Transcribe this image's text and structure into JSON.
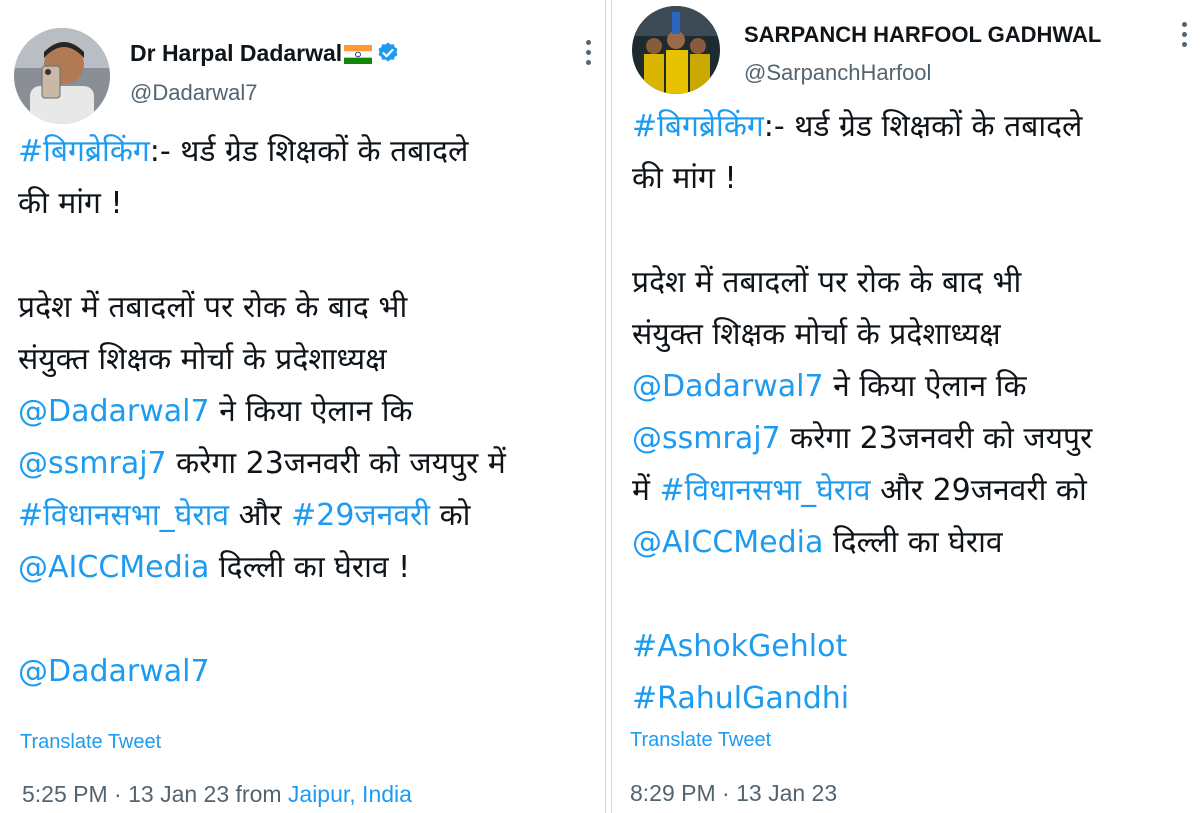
{
  "left_tweet": {
    "author": {
      "name": "Dr Harpal Dadarwal",
      "handle": "@Dadarwal7",
      "flag": "india-flag",
      "verified": true
    },
    "hashtag_heading": "#बिगब्रेकिंग",
    "heading_rest": ":- थर्ड ग्रेड शिक्षकों के तबादले",
    "heading_line2": "की मांग !",
    "para_line1": "प्रदेश में तबादलों पर रोक के बाद भी",
    "para_line2": "संयुक्त शिक्षक मोर्चा के प्रदेशाध्यक्ष",
    "mention_1": "@Dadarwal7",
    "para_line3_rest": " ने किया ऐलान कि",
    "mention_2": "@ssmraj7",
    "para_line4_rest": " करेगा 23जनवरी को जयपुर में",
    "hashtag_2": "#विधानसभा_घेराव",
    "para_line5_mid": " और ",
    "hashtag_3": "#29जनवरी",
    "para_line5_end": " को",
    "mention_3": "@AICCMedia",
    "para_line6_rest": " दिल्ली का घेराव !",
    "mention_4": "@Dadarwal7",
    "translate_label": "Translate Tweet",
    "timestamp": "5:25 PM · 13 Jan 23 from ",
    "location": "Jaipur, India"
  },
  "right_tweet": {
    "author": {
      "name": "SARPANCH HARFOOL GADHWAL",
      "handle": "@SarpanchHarfool"
    },
    "hashtag_heading": "#बिगब्रेकिंग",
    "heading_rest": ":- थर्ड ग्रेड शिक्षकों के तबादले",
    "heading_line2": "की मांग !",
    "para_line1": "प्रदेश में तबादलों पर रोक के बाद भी",
    "para_line2": "संयुक्त शिक्षक मोर्चा के प्रदेशाध्यक्ष",
    "mention_1": "@Dadarwal7",
    "para_line3_rest": " ने किया ऐलान कि",
    "mention_2": "@ssmraj7",
    "para_line4_rest": " करेगा 23जनवरी को जयपुर",
    "para_line5_start": "में ",
    "hashtag_2": "#विधानसभा_घेराव",
    "para_line5_rest": " और 29जनवरी को",
    "mention_3": "@AICCMedia",
    "para_line6_rest": " दिल्ली का घेराव",
    "hashtag_4": "#AshokGehlot",
    "hashtag_5": "#RahulGandhi",
    "translate_label": "Translate Tweet",
    "timestamp": "8:29 PM · 13 Jan 23"
  },
  "colors": {
    "link": "#1d9bf0",
    "text": "#0f1419",
    "muted": "#536471"
  }
}
